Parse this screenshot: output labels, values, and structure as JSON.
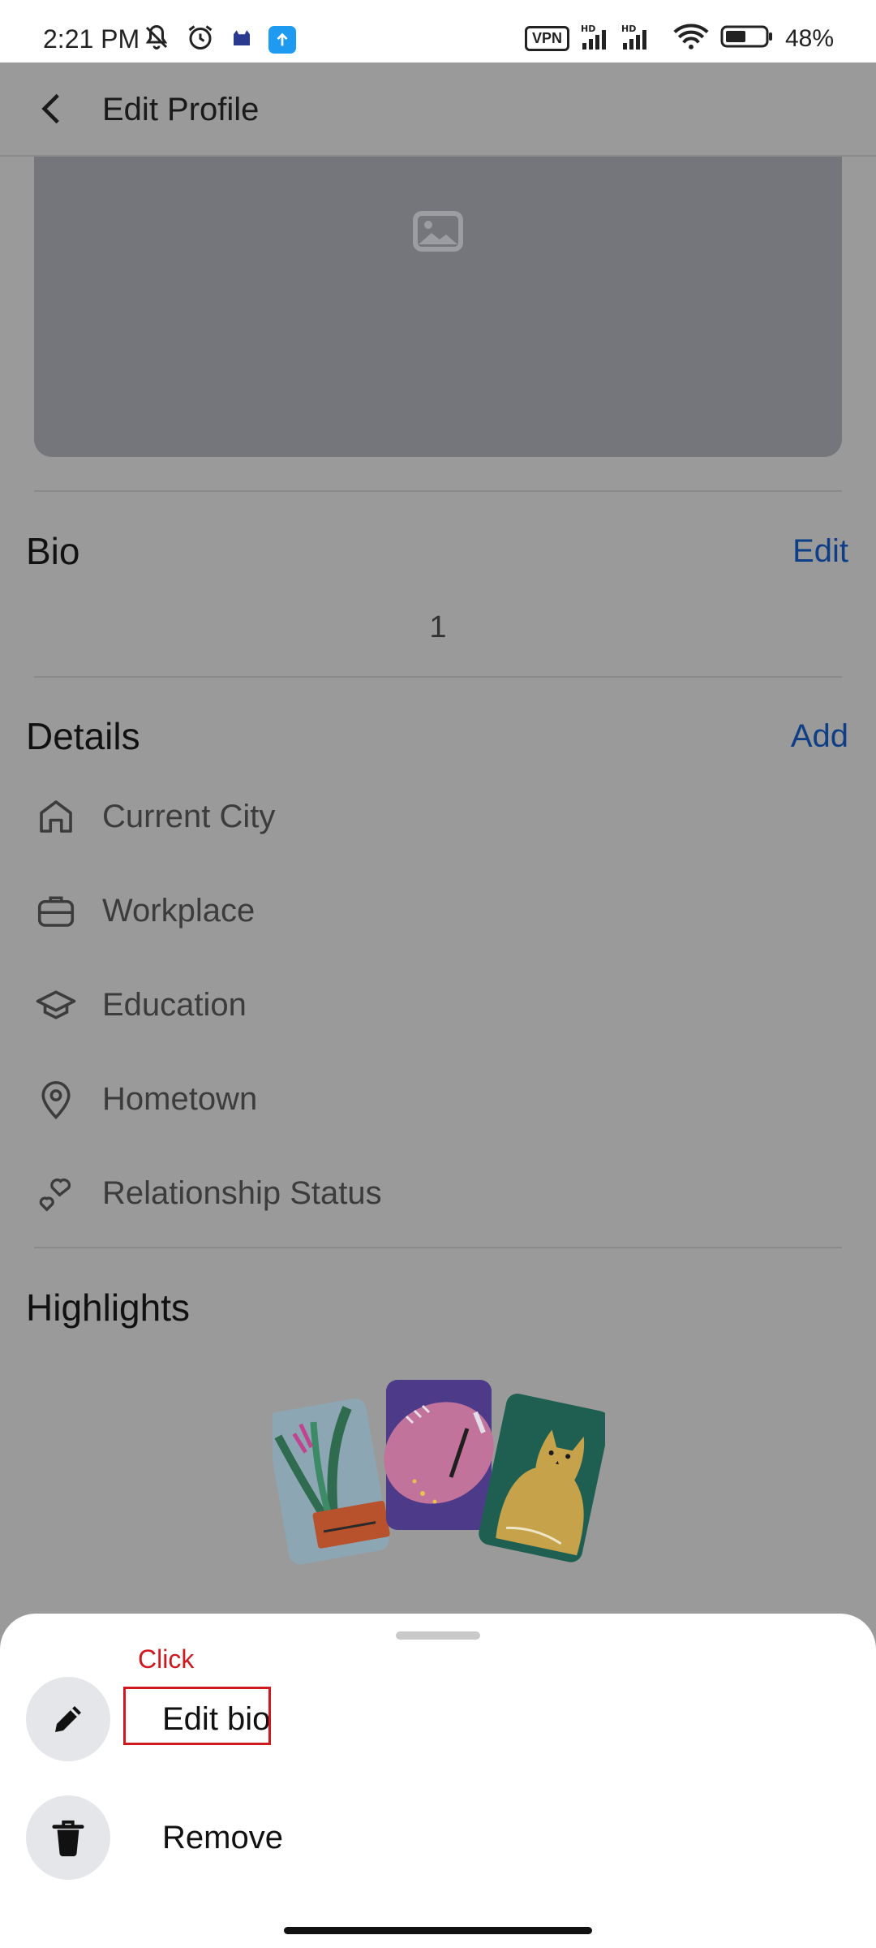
{
  "status_bar": {
    "time": "2:21 PM",
    "vpn": "VPN",
    "battery": "48%",
    "icons": [
      "mute-icon",
      "alarm-icon",
      "app-icon",
      "upload-icon",
      "hd-signal-icon",
      "wifi-icon",
      "battery-icon"
    ]
  },
  "header": {
    "title": "Edit Profile"
  },
  "bio": {
    "title": "Bio",
    "action": "Edit",
    "value": "1"
  },
  "details": {
    "title": "Details",
    "action": "Add",
    "items": [
      {
        "label": "Current City",
        "icon": "home-icon"
      },
      {
        "label": "Workplace",
        "icon": "briefcase-icon"
      },
      {
        "label": "Education",
        "icon": "graduation-cap-icon"
      },
      {
        "label": "Hometown",
        "icon": "location-pin-icon"
      },
      {
        "label": "Relationship Status",
        "icon": "hearts-icon"
      }
    ]
  },
  "highlights": {
    "title": "Highlights"
  },
  "sheet": {
    "annotation": "Click",
    "items": [
      {
        "label": "Edit bio",
        "icon": "pencil-icon"
      },
      {
        "label": "Remove",
        "icon": "trash-icon"
      }
    ]
  }
}
